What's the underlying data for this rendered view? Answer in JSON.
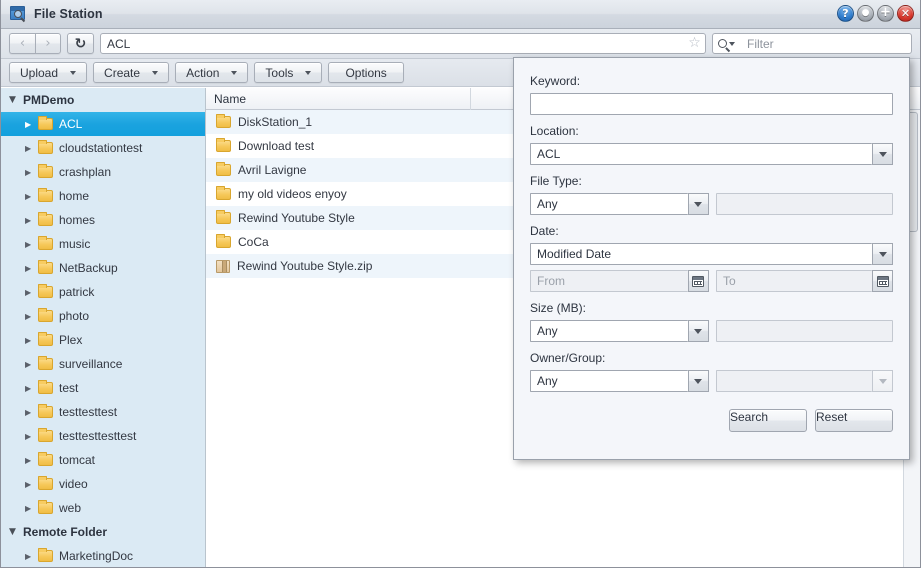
{
  "window": {
    "title": "File Station",
    "app_icon": "file-station-icon",
    "controls": [
      {
        "name": "help-button",
        "glyph": "?",
        "kind": "help"
      },
      {
        "name": "minimize-button",
        "glyph": "●",
        "kind": "min"
      },
      {
        "name": "maximize-button",
        "glyph": "+",
        "kind": "max"
      },
      {
        "name": "close-button",
        "glyph": "✕",
        "kind": "close"
      }
    ]
  },
  "navbar": {
    "back_icon": "‹",
    "forward_icon": "›",
    "refresh_icon": "↻",
    "path_value": "ACL",
    "path_placeholder": "",
    "favorite_icon": "☆",
    "filter_placeholder": "Filter",
    "filter_value": ""
  },
  "toolbar": {
    "buttons": [
      {
        "label": "Upload",
        "has_arrow": true
      },
      {
        "label": "Create",
        "has_arrow": true
      },
      {
        "label": "Action",
        "has_arrow": true
      },
      {
        "label": "Tools",
        "has_arrow": true
      },
      {
        "label": "Options",
        "has_arrow": false
      }
    ]
  },
  "sidebar": {
    "volume": {
      "label": "PMDemo",
      "twisty": "▼",
      "items": [
        {
          "label": "ACL",
          "selected": true
        },
        {
          "label": "cloudstationtest",
          "selected": false
        },
        {
          "label": "crashplan",
          "selected": false
        },
        {
          "label": "home",
          "selected": false
        },
        {
          "label": "homes",
          "selected": false
        },
        {
          "label": "music",
          "selected": false
        },
        {
          "label": "NetBackup",
          "selected": false
        },
        {
          "label": "patrick",
          "selected": false
        },
        {
          "label": "photo",
          "selected": false
        },
        {
          "label": "Plex",
          "selected": false
        },
        {
          "label": "surveillance",
          "selected": false
        },
        {
          "label": "test",
          "selected": false
        },
        {
          "label": "testtesttest",
          "selected": false
        },
        {
          "label": "testtesttesttest",
          "selected": false
        },
        {
          "label": "tomcat",
          "selected": false
        },
        {
          "label": "video",
          "selected": false
        },
        {
          "label": "web",
          "selected": false
        }
      ]
    },
    "remote": {
      "label": "Remote Folder",
      "twisty": "▼",
      "items": [
        {
          "label": "MarketingDoc",
          "selected": false
        }
      ]
    },
    "item_twisty": "▶"
  },
  "filelist": {
    "columns": [
      "Name",
      ""
    ],
    "rows": [
      {
        "name": "DiskStation_1",
        "type": "folder"
      },
      {
        "name": "Download test",
        "type": "folder"
      },
      {
        "name": "Avril Lavigne",
        "type": "folder"
      },
      {
        "name": "my old videos enyoy",
        "type": "folder"
      },
      {
        "name": "Rewind Youtube Style",
        "type": "folder"
      },
      {
        "name": "CoCa",
        "type": "folder"
      },
      {
        "name": "Rewind Youtube Style.zip",
        "type": "zip"
      }
    ],
    "background_rows": [
      "",
      "",
      "",
      "",
      "",
      "",
      ""
    ]
  },
  "search_panel": {
    "keyword": {
      "label": "Keyword:",
      "value": "",
      "placeholder": ""
    },
    "location": {
      "label": "Location:",
      "value": "ACL"
    },
    "filetype": {
      "label": "File Type:",
      "value": "Any",
      "extra_value": "",
      "extra_placeholder": ""
    },
    "date": {
      "label": "Date:",
      "value": "Modified Date",
      "from_placeholder": "From",
      "from_value": "",
      "to_placeholder": "To",
      "to_value": ""
    },
    "size": {
      "label": "Size (MB):",
      "value": "Any",
      "extra_value": "",
      "extra_placeholder": ""
    },
    "owner": {
      "label": "Owner/Group:",
      "value": "Any",
      "extra_value": "",
      "extra_placeholder": ""
    },
    "search_label": "Search",
    "reset_label": "Reset"
  },
  "colors": {
    "accent_selected": "#1ba3df",
    "sidebar_bg": "#dbeaf4",
    "row_alt": "#eef5fb",
    "panel_bg": "#f4f6fa",
    "close_red": "#d8372c",
    "help_blue": "#2f7ccc",
    "folder_yellow": "#f6c85a"
  }
}
